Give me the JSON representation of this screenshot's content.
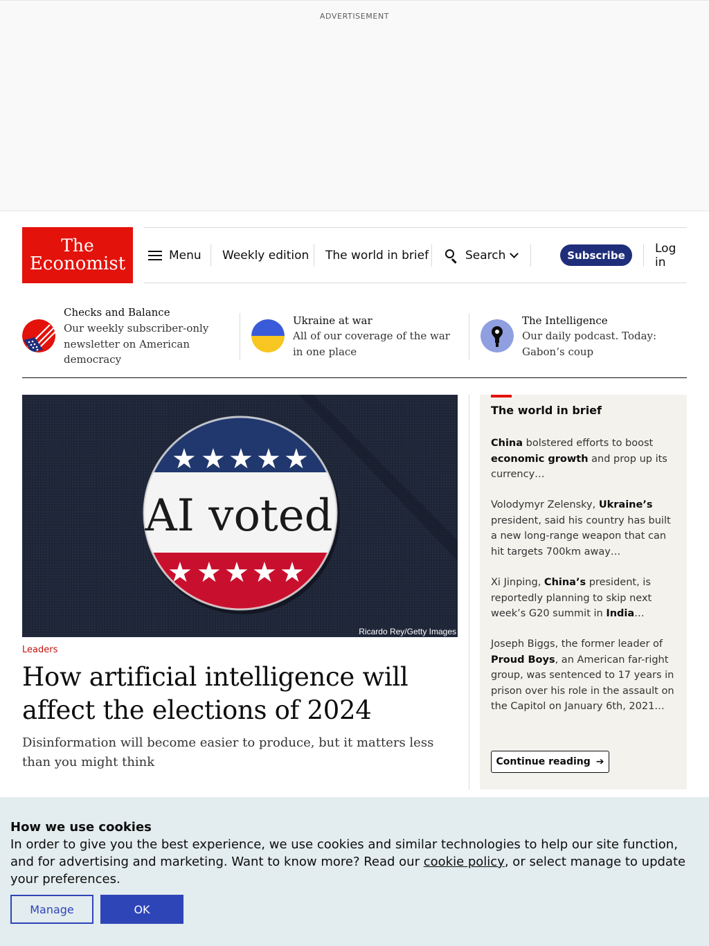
{
  "ad": {
    "label": "ADVERTISEMENT"
  },
  "header": {
    "logo_line1": "The",
    "logo_line2": "Economist",
    "menu_label": "Menu",
    "weekly_label": "Weekly edition",
    "brief_label": "The world in brief",
    "search_label": "Search",
    "subscribe_label": "Subscribe",
    "login_label": "Log in"
  },
  "promos": [
    {
      "title": "Checks and Balance",
      "desc": "Our weekly subscriber-only newsletter on American democracy",
      "icon": "flag-icon"
    },
    {
      "title": "Ukraine at war",
      "desc": "All of our coverage of the war in one place",
      "icon": "ukraine-flag-icon"
    },
    {
      "title": "The Intelligence",
      "desc": "Our daily podcast. Today: Gabon’s coup",
      "icon": "podcast-icon"
    }
  ],
  "article": {
    "image_text": "AI voted",
    "credit": "Ricardo Rey/Getty Images",
    "rubric": "Leaders",
    "headline": "How artificial intelligence will affect the elections of 2024",
    "standfirst": "Disinformation will become easier to produce, but it matters less than you might think"
  },
  "world_in_brief": {
    "title": "The world in brief",
    "items": [
      {
        "parts": [
          {
            "t": "China",
            "b": true
          },
          {
            "t": " bolstered efforts to boost ",
            "b": false
          },
          {
            "t": "economic growth",
            "b": true
          },
          {
            "t": " and prop up its currency…",
            "b": false
          }
        ]
      },
      {
        "parts": [
          {
            "t": "Volodymyr Zelensky, ",
            "b": false
          },
          {
            "t": "Ukraine’s",
            "b": true
          },
          {
            "t": " president, said his country has built a new long-range weapon that can hit targets 700km away…",
            "b": false
          }
        ]
      },
      {
        "parts": [
          {
            "t": "Xi Jinping, ",
            "b": false
          },
          {
            "t": "China’s",
            "b": true
          },
          {
            "t": " president, is reportedly planning to skip next week’s G20 summit in ",
            "b": false
          },
          {
            "t": "India",
            "b": true
          },
          {
            "t": "…",
            "b": false
          }
        ]
      },
      {
        "parts": [
          {
            "t": "Joseph Biggs, the former leader of ",
            "b": false
          },
          {
            "t": "Proud Boys",
            "b": true
          },
          {
            "t": ", an American far-right group, was sentenced to 17 years in prison over his role in the assault on the Capitol on January 6th, 2021…",
            "b": false
          }
        ]
      }
    ],
    "continue_label": "Continue reading"
  },
  "cookie": {
    "title": "How we use cookies",
    "text_before": "In order to give you the best experience, we use cookies and similar technologies to help our site function, and for advertising and marketing. Want to know more? Read our ",
    "link": "cookie policy",
    "text_after": ", or select manage to update your preferences.",
    "manage_label": "Manage",
    "ok_label": "OK"
  },
  "colors": {
    "brand_red": "#e3120b",
    "navy": "#1f2e7a",
    "cookie_blue": "#2e45b8",
    "brief_bg": "#f4f2ed"
  }
}
